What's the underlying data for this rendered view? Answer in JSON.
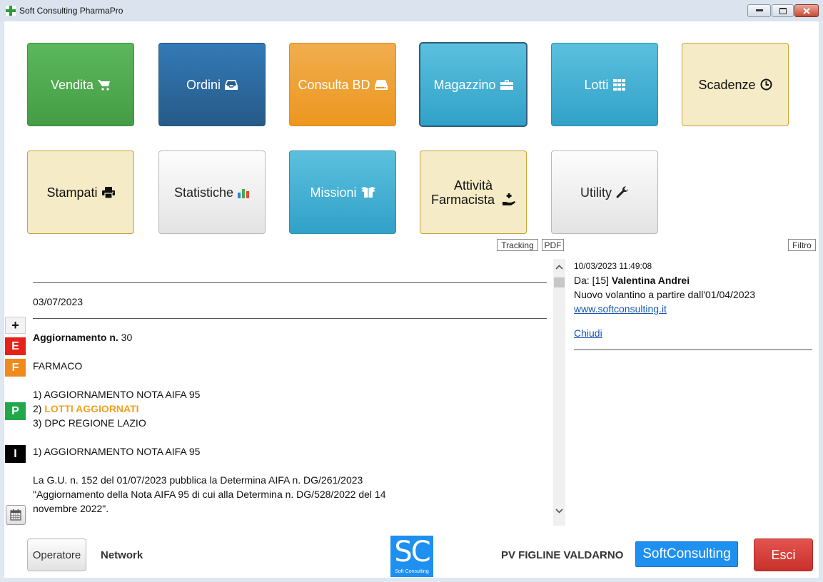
{
  "window": {
    "title": "Soft Consulting PharmaPro"
  },
  "tiles": [
    {
      "label": "Vendita",
      "icon": "cart-icon"
    },
    {
      "label": "Ordini",
      "icon": "inbox-icon"
    },
    {
      "label": "Consulta BD",
      "icon": "hdd-icon"
    },
    {
      "label": "Magazzino",
      "icon": "briefcase-icon"
    },
    {
      "label": "Lotti",
      "icon": "grid-icon"
    },
    {
      "label": "Scadenze",
      "icon": "clock-icon"
    },
    {
      "label": "Stampati",
      "icon": "print-icon"
    },
    {
      "label": "Statistiche",
      "icon": "bar-chart-icon"
    },
    {
      "label": "Missioni",
      "icon": "box-open-icon"
    },
    {
      "label_line1": "Attività",
      "label_line2": "Farmacista",
      "icon": "hand-holding-medical-icon"
    },
    {
      "label": "Utility",
      "icon": "wrench-icon"
    }
  ],
  "toolbar": {
    "tracking": "Tracking",
    "pdf": "PDF",
    "filtro": "Filtro"
  },
  "news": {
    "date": "03/07/2023",
    "update_label": "Aggiornamento n.",
    "update_number": "30",
    "section": "FARMACO",
    "items": [
      {
        "num": "1)",
        "text": "AGGIORNAMENTO NOTA AIFA 95"
      },
      {
        "num": "2)",
        "text": "LOTTI AGGIORNATI"
      },
      {
        "num": "3)",
        "text": "DPC REGIONE LAZIO"
      }
    ],
    "detail_title": "1) AGGIORNAMENTO NOTA AIFA 95",
    "body_line1": "La G.U. n. 152 del 01/07/2023 pubblica la Determina AIFA n. DG/261/2023",
    "body_line2": "\"Aggiornamento della Nota AIFA 95 di cui alla Determina n. DG/528/2022 del 14",
    "body_line3": "novembre 2022\"."
  },
  "side_badges": {
    "plus": "+",
    "e": "E",
    "f": "F",
    "p": "P",
    "i": "I"
  },
  "colors": {
    "badge_e": "#e8201a",
    "badge_f": "#f08a1c",
    "badge_p": "#20a84a",
    "badge_i": "#000000"
  },
  "message": {
    "timestamp": "10/03/2023 11:49:08",
    "from_label": "Da: [15]",
    "from_name": "Valentina Andrei",
    "text": "Nuovo volantino a partire dall'01/04/2023",
    "link": "www.softconsulting.it",
    "close": "Chiudi"
  },
  "footer": {
    "operatore": "Operatore",
    "network": "Network",
    "logo_big": "SC",
    "logo_small": "Soft Consulting",
    "pv": "PV FIGLINE VALDARNO",
    "softconsulting": "SoftConsulting",
    "esci": "Esci"
  }
}
